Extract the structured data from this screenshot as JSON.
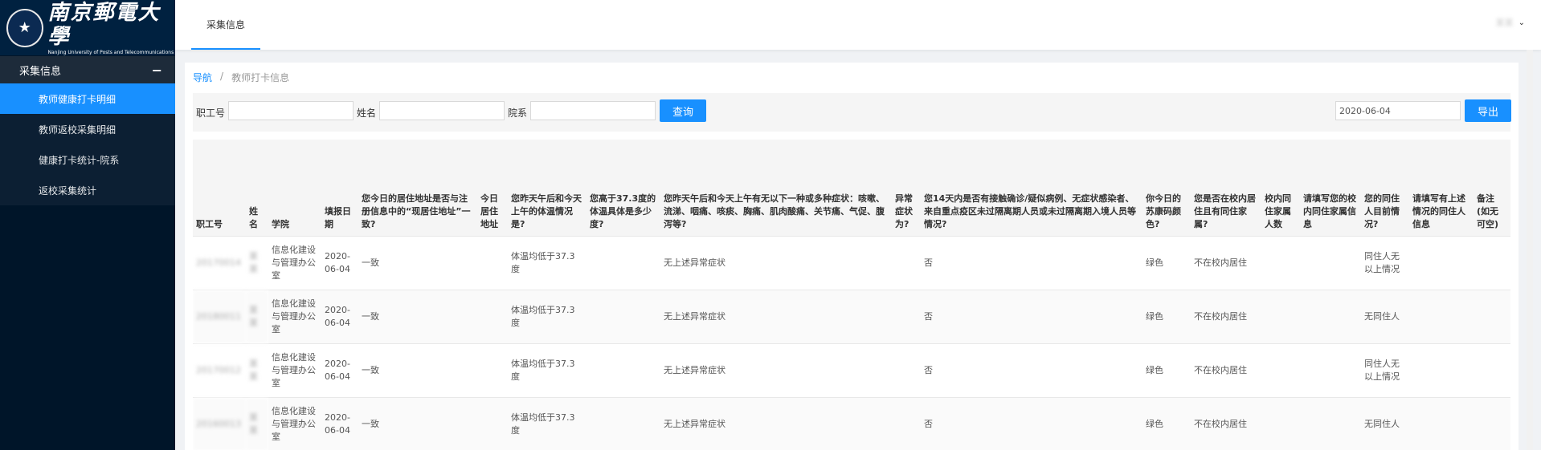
{
  "sidebar": {
    "logo_cn": "南京郵電大學",
    "logo_en": "Nanjing University of Posts and Telecommunications",
    "group_label": "采集信息",
    "group_toggle": "−",
    "items": [
      {
        "label": "教师健康打卡明细",
        "active": true
      },
      {
        "label": "教师返校采集明细",
        "active": false
      },
      {
        "label": "健康打卡统计-院系",
        "active": false
      },
      {
        "label": "返校采集统计",
        "active": false
      }
    ]
  },
  "header": {
    "tab": "采集信息",
    "user": "某某",
    "chevron": "⌄"
  },
  "breadcrumb": {
    "home": "导航",
    "sep": "/",
    "current": "教师打卡信息"
  },
  "search": {
    "staff_id_label": "职工号",
    "staff_id_value": "",
    "name_label": "姓名",
    "name_value": "",
    "dept_label": "院系",
    "dept_value": "",
    "query_button": "查询",
    "date_value": "2020-06-04",
    "export_button": "导出"
  },
  "table": {
    "headers": [
      "职工号",
      "姓名",
      "学院",
      "填报日期",
      "您今日的居住地址是否与注册信息中的“现居住地址”一致?",
      "今日居住地址",
      "您昨天午后和今天上午的体温情况是?",
      "您高于37.3度的体温具体是多少度?",
      "您昨天午后和今天上午有无以下一种或多种症状：咳嗽、流涕、咽痛、咳痰、胸痛、肌肉酸痛、关节痛、气促、腹泻等?",
      "异常症状为?",
      "您14天内是否有接触确诊/疑似病例、无症状感染者、来自重点疫区未过隔离期人员或未过隔离期入境人员等情况?",
      "你今日的苏康码颜色?",
      "您是否在校内居住且有同住家属?",
      "校内同住家属人数",
      "请填写您的校内同住家属信息",
      "您的同住人目前情况?",
      "请填写有上述情况的同住人信息",
      "备注(如无可空)"
    ],
    "rows": [
      [
        "20170014",
        "某某",
        "信息化建设与管理办公室",
        "2020-06-04",
        "一致",
        "",
        "体温均低于37.3度",
        "",
        "无上述异常症状",
        "",
        "否",
        "绿色",
        "不在校内居住",
        "",
        "",
        "同住人无以上情况",
        "",
        ""
      ],
      [
        "20180011",
        "某某",
        "信息化建设与管理办公室",
        "2020-06-04",
        "一致",
        "",
        "体温均低于37.3度",
        "",
        "无上述异常症状",
        "",
        "否",
        "绿色",
        "不在校内居住",
        "",
        "",
        "无同住人",
        "",
        ""
      ],
      [
        "20170012",
        "某某",
        "信息化建设与管理办公室",
        "2020-06-04",
        "一致",
        "",
        "体温均低于37.3度",
        "",
        "无上述异常症状",
        "",
        "否",
        "绿色",
        "不在校内居住",
        "",
        "",
        "同住人无以上情况",
        "",
        ""
      ],
      [
        "20160013",
        "某某",
        "信息化建设与管理办公室",
        "2020-06-04",
        "一致",
        "",
        "体温均低于37.3度",
        "",
        "无上述异常症状",
        "",
        "否",
        "绿色",
        "不在校内居住",
        "",
        "",
        "无同住人",
        "",
        ""
      ]
    ]
  }
}
